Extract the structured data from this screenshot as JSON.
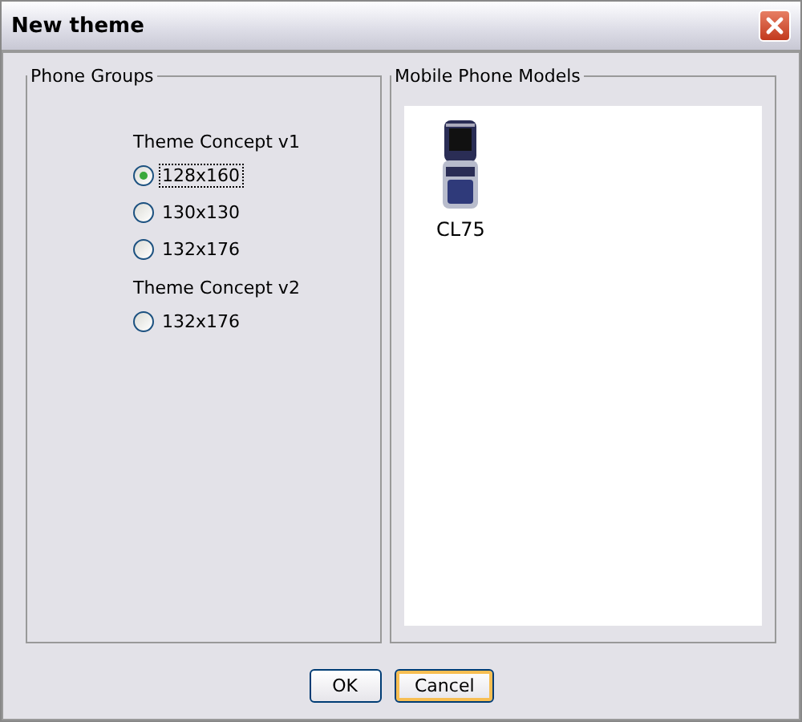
{
  "window": {
    "title": "New theme"
  },
  "phone_groups": {
    "title": "Phone Groups",
    "groups": [
      {
        "label": "Theme Concept v1",
        "options": [
          {
            "label": "128x160",
            "selected": true,
            "focused": true
          },
          {
            "label": "130x130",
            "selected": false,
            "focused": false
          },
          {
            "label": "132x176",
            "selected": false,
            "focused": false
          }
        ]
      },
      {
        "label": "Theme Concept v2",
        "options": [
          {
            "label": "132x176",
            "selected": false,
            "focused": false
          }
        ]
      }
    ]
  },
  "models": {
    "title": "Mobile Phone Models",
    "items": [
      {
        "label": "CL75"
      }
    ]
  },
  "buttons": [
    {
      "label": "OK",
      "focused": false
    },
    {
      "label": "Cancel",
      "focused": true
    }
  ]
}
